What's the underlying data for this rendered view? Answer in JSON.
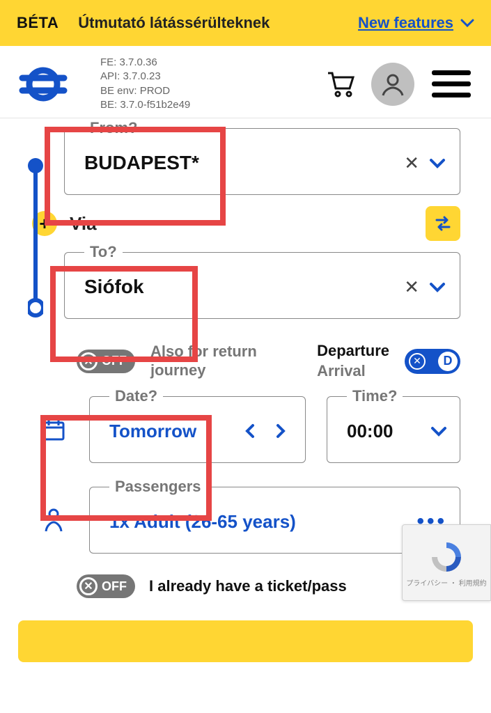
{
  "banner": {
    "beta": "BÉTA",
    "guide": "Útmutató látássérülteknek",
    "link": "New features"
  },
  "versions": {
    "fe": "FE: 3.7.0.36",
    "api": "API: 3.7.0.23",
    "env": "BE env: PROD",
    "be": "BE: 3.7.0-f51b2e49"
  },
  "from": {
    "label": "From?",
    "value": "BUDAPEST*"
  },
  "via": {
    "label": "Via"
  },
  "to": {
    "label": "To?",
    "value": "Siófok"
  },
  "return": {
    "toggle": "OFF",
    "label": "Also for return journey"
  },
  "deparr": {
    "departure": "Departure",
    "arrival": "Arrival",
    "toggle": "D"
  },
  "date": {
    "label": "Date?",
    "value": "Tomorrow"
  },
  "time": {
    "label": "Time?",
    "value": "00:00"
  },
  "pax": {
    "label": "Passengers",
    "value": "1x Adult (26-65 years)"
  },
  "haveTicket": {
    "toggle": "OFF",
    "label": "I already have a ticket/pass"
  },
  "recaptcha": {
    "terms": "プライバシー ・ 利用規約"
  }
}
